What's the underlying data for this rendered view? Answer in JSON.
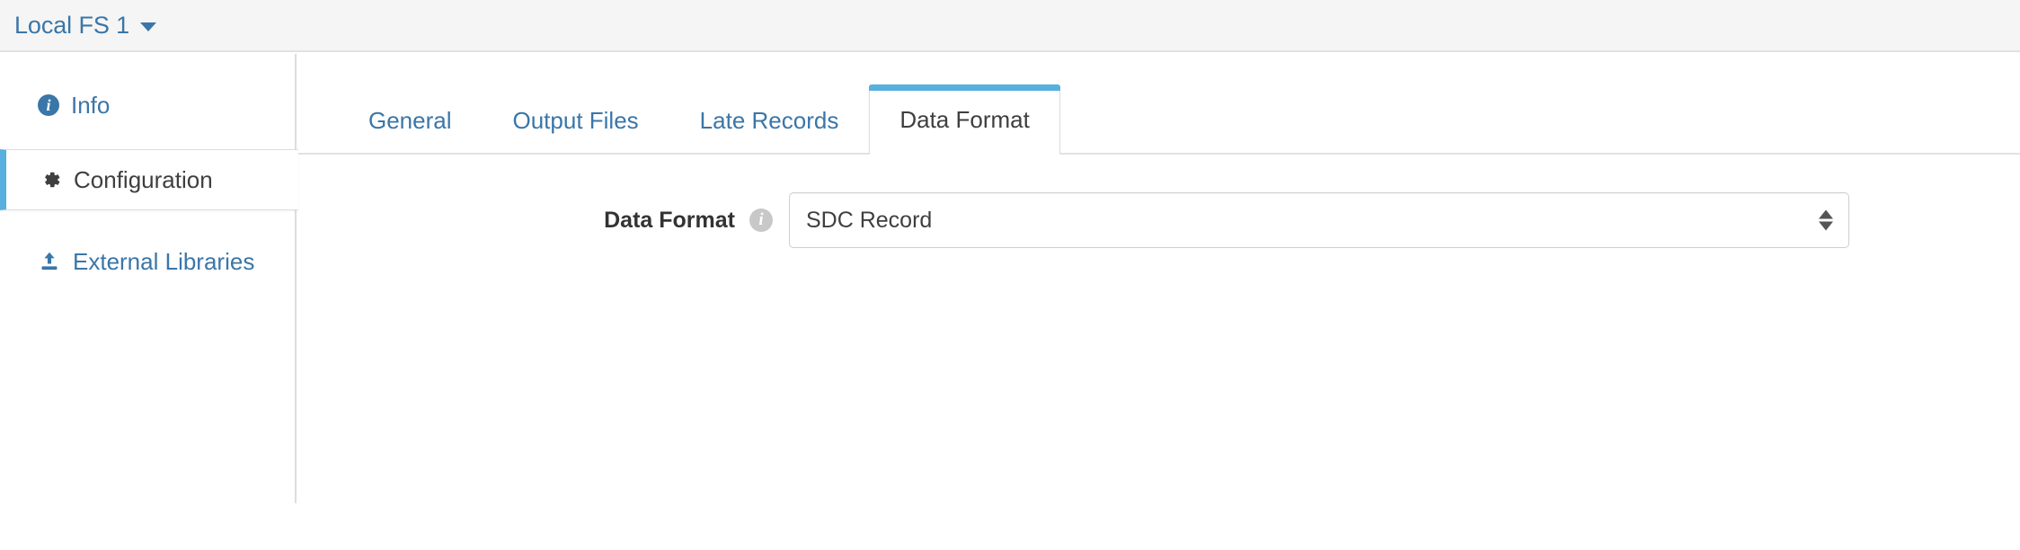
{
  "header": {
    "title": "Local FS 1",
    "caret_icon": "caret-down-icon"
  },
  "sidebar": {
    "items": [
      {
        "label": "Info",
        "icon": "info-circle-icon",
        "active": false
      },
      {
        "label": "Configuration",
        "icon": "gear-icon",
        "active": true
      },
      {
        "label": "External Libraries",
        "icon": "upload-icon",
        "active": false
      }
    ]
  },
  "main": {
    "tabs": [
      {
        "label": "General",
        "active": false
      },
      {
        "label": "Output Files",
        "active": false
      },
      {
        "label": "Late Records",
        "active": false
      },
      {
        "label": "Data Format",
        "active": true
      }
    ],
    "form": {
      "data_format": {
        "label": "Data Format",
        "help_icon": "info-help-icon",
        "value": "SDC Record",
        "spinner_icon": "spinner-arrows"
      }
    }
  },
  "colors": {
    "link": "#3a76a8",
    "accent": "#57b0de",
    "header_bg": "#f5f5f5",
    "border": "#dddddd",
    "text": "#3f3f3f"
  }
}
